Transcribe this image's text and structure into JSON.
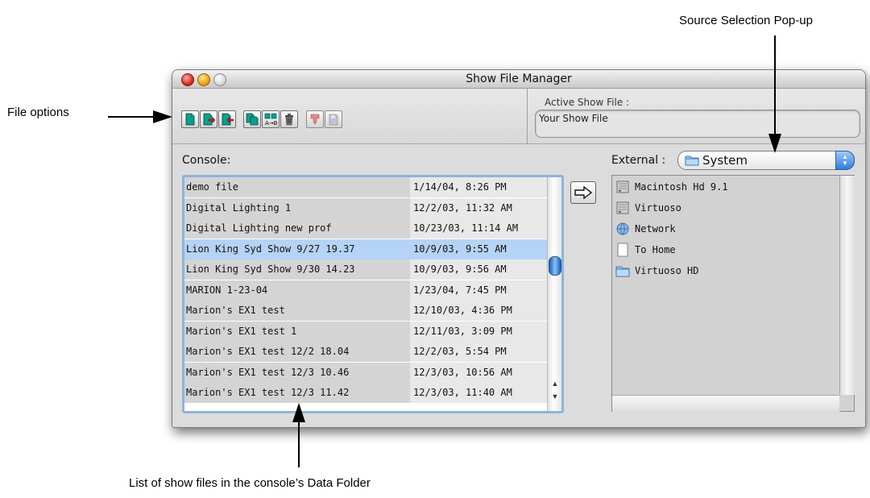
{
  "callouts": {
    "file_options": "File options",
    "source_selection": "Source Selection Pop-up",
    "list_of_files": "List of show files in the console’s Data Folder"
  },
  "window": {
    "title": "Show File Manager"
  },
  "toolbar": {
    "buttons": [
      "new-file",
      "save-as",
      "import",
      "copy",
      "compare",
      "delete",
      "download",
      "disk"
    ]
  },
  "active_show": {
    "label": "Active Show File :",
    "value": "Your Show File"
  },
  "console": {
    "label": "Console:",
    "files": [
      {
        "name": "demo file",
        "date": "1/14/04, 8:26 PM"
      },
      {
        "name": "Digital Lighting 1",
        "date": "12/2/03, 11:32 AM"
      },
      {
        "name": "Digital Lighting new prof",
        "date": "10/23/03, 11:14 AM"
      },
      {
        "name": "Lion King Syd Show 9/27 19.37",
        "date": "10/9/03, 9:55 AM"
      },
      {
        "name": "Lion King Syd Show 9/30 14.23",
        "date": "10/9/03, 9:56 AM"
      },
      {
        "name": "MARION 1-23-04",
        "date": "1/23/04, 7:45 PM"
      },
      {
        "name": "Marion's EX1 test",
        "date": "12/10/03, 4:36 PM"
      },
      {
        "name": "Marion's EX1 test 1",
        "date": "12/11/03, 3:09 PM"
      },
      {
        "name": "Marion's EX1 test 12/2 18.04",
        "date": "12/2/03, 5:54 PM"
      },
      {
        "name": "Marion's EX1 test 12/3 10.46",
        "date": "12/3/03, 10:56 AM"
      },
      {
        "name": "Marion's EX1 test 12/3 11.42",
        "date": "12/3/03, 11:40 AM"
      }
    ],
    "selected_index": 3
  },
  "external": {
    "label": "External :",
    "source": "System",
    "items": [
      {
        "name": "Macintosh Hd 9.1",
        "icon": "hard-disk-icon"
      },
      {
        "name": "Virtuoso",
        "icon": "hard-disk-icon"
      },
      {
        "name": "Network",
        "icon": "network-globe-icon"
      },
      {
        "name": "To Home",
        "icon": "document-icon"
      },
      {
        "name": "Virtuoso HD",
        "icon": "folder-icon"
      }
    ]
  },
  "colors": {
    "selection": "#b5d3f5",
    "list_focus_border": "#8eb3dc",
    "name_column": "#d4d4d4",
    "date_column": "#e8e8e8"
  }
}
